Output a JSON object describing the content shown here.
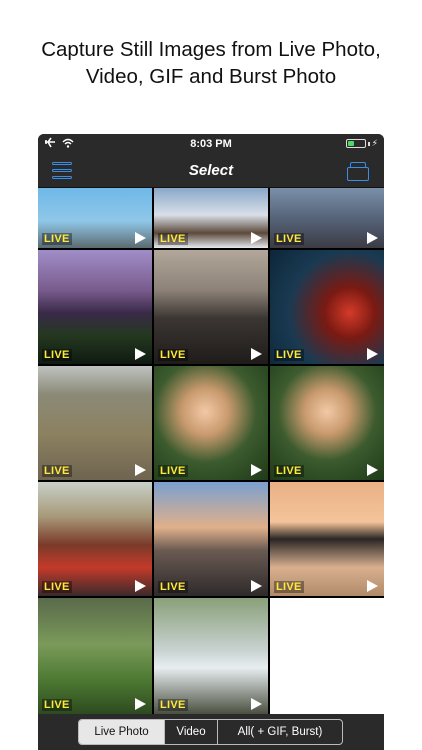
{
  "headline": {
    "line1": "Capture Still Images from Live Photo,",
    "line2": "Video, GIF and Burst Photo"
  },
  "statusbar": {
    "time": "8:03 PM",
    "icons": [
      "airplane-icon",
      "wifi-icon",
      "battery-icon",
      "charging-icon"
    ]
  },
  "navbar": {
    "title": "Select",
    "left_icon": "menu-icon",
    "right_icon": "albums-icon",
    "accent_color": "#3a8ee6"
  },
  "grid": {
    "items": [
      {
        "badge": "LIVE",
        "scene": "Eiffel tower"
      },
      {
        "badge": "LIVE",
        "scene": "snowy cabin"
      },
      {
        "badge": "LIVE",
        "scene": "city dusk"
      },
      {
        "badge": "LIVE",
        "scene": "purple mountain"
      },
      {
        "badge": "LIVE",
        "scene": "mountain valley"
      },
      {
        "badge": "LIVE",
        "scene": "christmas ornaments"
      },
      {
        "badge": "LIVE",
        "scene": "dog on field"
      },
      {
        "badge": "LIVE",
        "scene": "girl blowing bubbles"
      },
      {
        "badge": "LIVE",
        "scene": "girl with bubbles"
      },
      {
        "badge": "LIVE",
        "scene": "van interior"
      },
      {
        "badge": "LIVE",
        "scene": "city skyline"
      },
      {
        "badge": "LIVE",
        "scene": "mountain lake sunset"
      },
      {
        "badge": "LIVE",
        "scene": "hiker on hill"
      },
      {
        "badge": "LIVE",
        "scene": "waterfall"
      },
      {
        "badge": "",
        "scene": "empty"
      }
    ],
    "badge_color": "#ffe93a"
  },
  "tabbar": {
    "segments": [
      {
        "label": "Live Photo",
        "active": true
      },
      {
        "label": "Video",
        "active": false
      },
      {
        "label": "All( + GIF, Burst)",
        "active": false
      }
    ]
  }
}
